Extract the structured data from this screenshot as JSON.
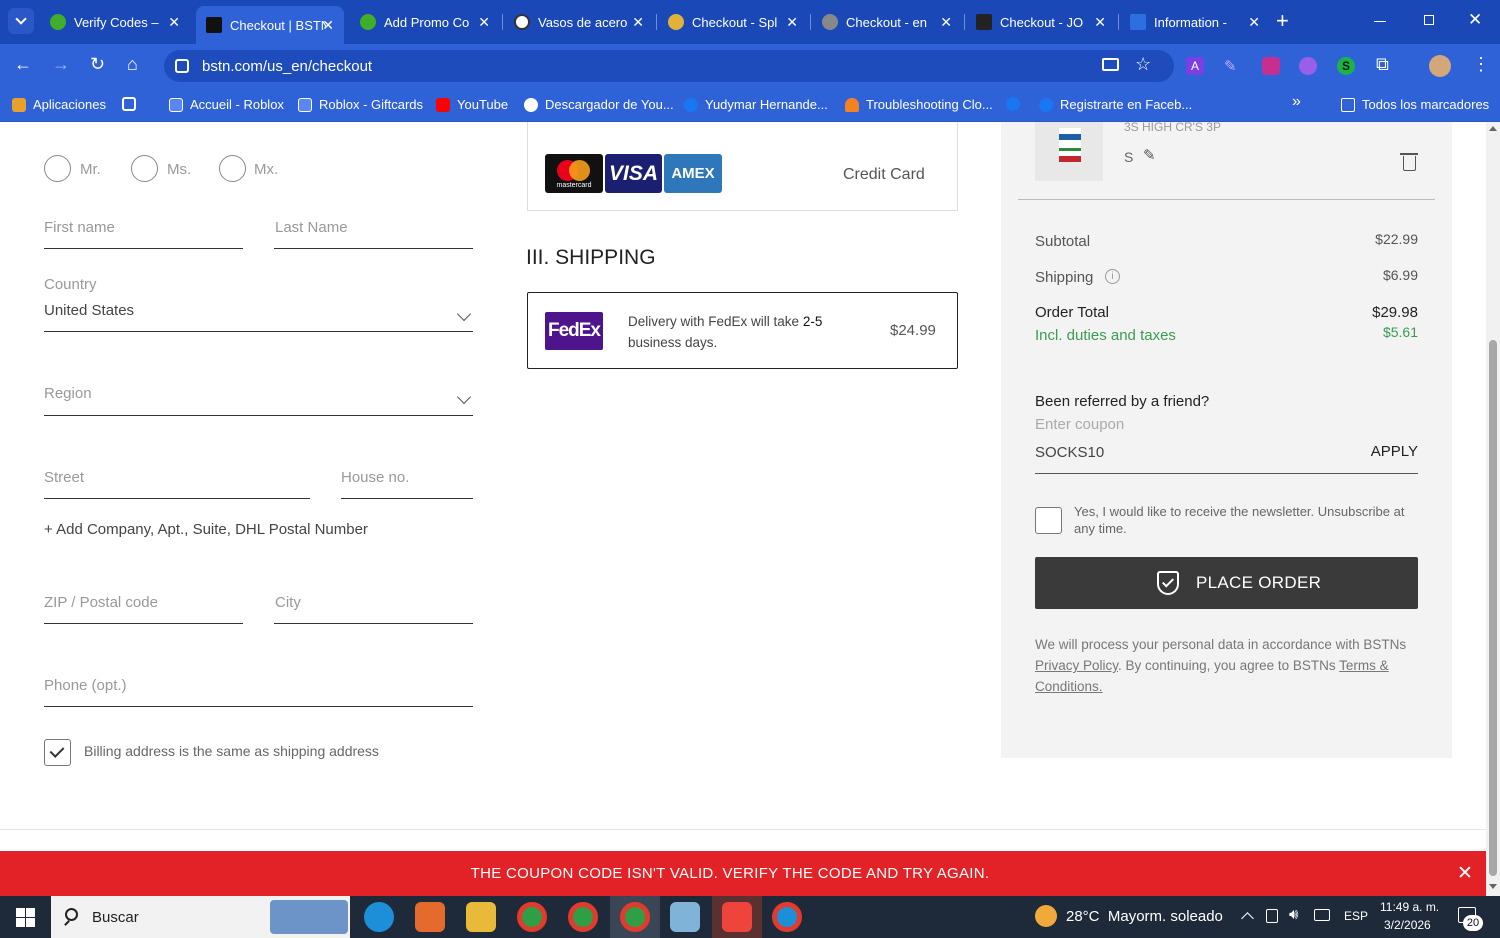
{
  "browser": {
    "tabs": [
      {
        "title": "Verify Codes –",
        "color": "#3fae2a"
      },
      {
        "title": "Checkout | BSTN",
        "color": "#111111"
      },
      {
        "title": "Add Promo Co",
        "color": "#3fae2a"
      },
      {
        "title": "Vasos de acero",
        "color": "#333333"
      },
      {
        "title": "Checkout - Spl",
        "color": "#e0b23a"
      },
      {
        "title": "Checkout - en",
        "color": "#888888"
      },
      {
        "title": "Checkout - JO",
        "color": "#222222"
      },
      {
        "title": "Information - ",
        "color": "#2b6fe0"
      }
    ],
    "url": "bstn.com/us_en/checkout",
    "bookmarks": [
      {
        "label": "Aplicaciones",
        "color": "#e8a12c"
      },
      {
        "label": "",
        "color": "#3062d7"
      },
      {
        "label": "Accueil - Roblox",
        "color": "#5a86f0"
      },
      {
        "label": "Roblox - Giftcards",
        "color": "#5a86f0"
      },
      {
        "label": "YouTube",
        "color": "#ff0000"
      },
      {
        "label": "Descargador de You...",
        "color": "#ffffff"
      },
      {
        "label": "Yudymar Hernande...",
        "color": "#1877f2"
      },
      {
        "label": "Troubleshooting Clo...",
        "color": "#f58220"
      },
      {
        "label": "",
        "color": "#1877f2"
      },
      {
        "label": "Registrarte en Faceb...",
        "color": "#1877f2"
      }
    ],
    "all_bookmarks": "Todos los marcadores"
  },
  "form": {
    "titles": [
      "Mr.",
      "Ms.",
      "Mx."
    ],
    "first_name_ph": "First name",
    "last_name_ph": "Last Name",
    "country_label": "Country",
    "country_value": "United States",
    "region_ph": "Region",
    "street_ph": "Street",
    "house_ph": "House no.",
    "add_company": "+ Add Company, Apt., Suite, DHL Postal Number",
    "zip_ph": "ZIP / Postal code",
    "city_ph": "City",
    "phone_ph": "Phone (opt.)",
    "billing_same": "Billing address is the same as shipping address"
  },
  "payment": {
    "mastercard": "mastercard",
    "visa": "VISA",
    "amex": "AMEX",
    "label": "Credit Card"
  },
  "shipping": {
    "heading": "III. SHIPPING",
    "carrier": "FedEx",
    "desc_pre": "Delivery with FedEx will take ",
    "desc_bold": "2-5",
    "desc_post": "business days.",
    "price": "$24.99"
  },
  "summary": {
    "item_name": "3S HIGH CR'S 3P",
    "item_size": "S",
    "subtotal_label": "Subtotal",
    "subtotal": "$22.99",
    "shipping_label": "Shipping",
    "shipping": "$6.99",
    "total_label": "Order Total",
    "total": "$29.98",
    "duties_label": "Incl. duties and taxes",
    "duties": "$5.61",
    "referral_title": "Been referred by a friend?",
    "coupon_ph": "Enter coupon",
    "coupon_value": "SOCKS10",
    "apply": "APPLY",
    "newsletter": "Yes, I would like to receive the newsletter. Unsubscribe at any time.",
    "place_order": "PLACE ORDER",
    "privacy_pre": "We will process your personal data in accordance with BSTNs ",
    "privacy_link": "Privacy Policy",
    "privacy_mid": ". By continuing, you agree to BSTNs ",
    "terms_link": "Terms & Conditions."
  },
  "error": "THE COUPON CODE ISN'T VALID. VERIFY THE CODE AND TRY AGAIN.",
  "taskbar": {
    "search": "Buscar",
    "weather": "28°C  Mayorm. soleado",
    "lang": "ESP",
    "time": "11:49 a. m.",
    "date": "3/2/2026",
    "notif": "20"
  }
}
